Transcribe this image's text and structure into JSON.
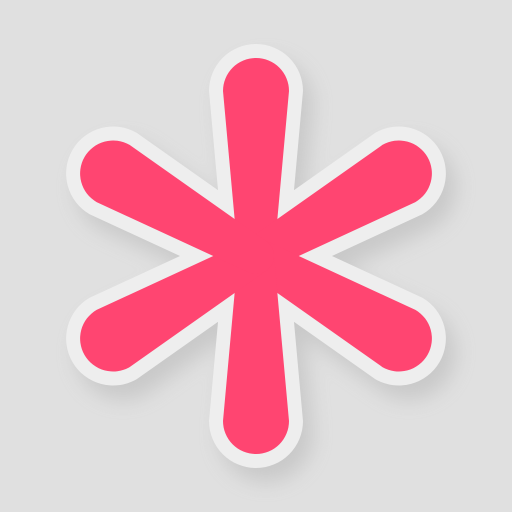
{
  "icon": {
    "name": "asterisk-icon",
    "arm_count": 6,
    "colors": {
      "background": "#e0e0e0",
      "outline": "#eeeeee",
      "fill": "#ff4571",
      "shadow": "#9e9e9e"
    }
  }
}
